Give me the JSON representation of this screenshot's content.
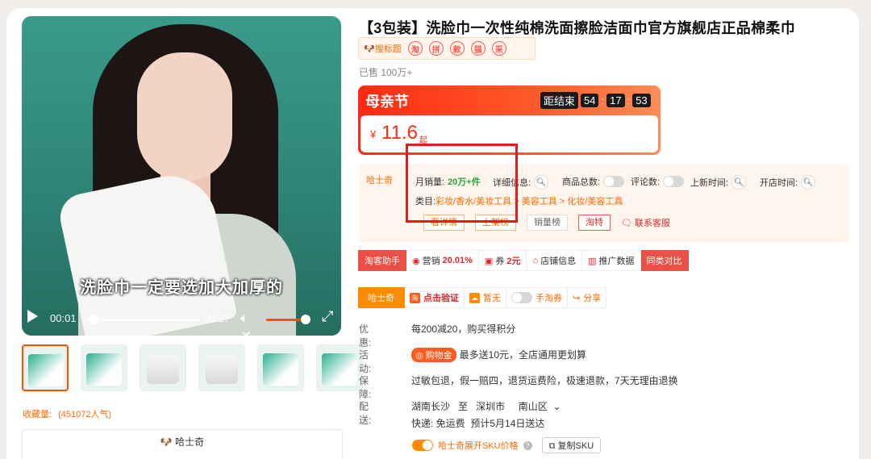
{
  "product": {
    "title": "【3包装】洗脸巾一次性纯棉洗面擦脸洁面巾官方旗舰店正品棉柔巾",
    "sold": "已售 100万+",
    "badge_label": "搜标题",
    "badge_icons": [
      "淘",
      "拼",
      "款",
      "猫",
      "采"
    ]
  },
  "video": {
    "caption": "洗脸巾一定要选加大加厚的",
    "current_time": "00:01",
    "duration": "00:27",
    "progress": 0.04,
    "volume": 0.85
  },
  "thumbnails": {
    "count": 6,
    "selected": 0
  },
  "favorites": {
    "label": "收藏量:",
    "value": "(451072人气)"
  },
  "husky_panel": {
    "label": "哈士奇"
  },
  "promo": {
    "title": "母亲节",
    "countdown_label": "距结束",
    "h": "54",
    "m": "17",
    "s": "53",
    "currency": "¥",
    "price": "11.6",
    "suffix": "起"
  },
  "analytics": {
    "brand": "哈士奇",
    "monthly_label": "月销量:",
    "monthly_value": "20万+件",
    "detail_label": "详细信息:",
    "total_label": "商品总数:",
    "review_label": "评论数:",
    "new_label": "上新时间:",
    "open_label": "开店时间:",
    "cat_label": "类目:",
    "cat_path": [
      "彩妆/香水/美妆工具",
      "美容工具",
      "化妆/美容工具"
    ],
    "cat_sep": " > ",
    "btn1": "看详情",
    "btn2": "上架榜",
    "btn3": "销量榜",
    "btn4": "淘特",
    "contact": "联系客服"
  },
  "toolbar": {
    "assistant": "淘客助手",
    "marketing_label": "营销",
    "marketing_value": "20.01%",
    "coupon_label": "券",
    "coupon_value": "2元",
    "shop_info": "店铺信息",
    "promo_data": "推广数据",
    "compare": "同类对比"
  },
  "toolbar2": {
    "husky": "哈士奇",
    "verify": "点击验证",
    "none": "暂无",
    "taobao": "手淘券",
    "share": "分享"
  },
  "info": {
    "discount_k": "优惠:",
    "discount_v": "每200减20，购买得积分",
    "activity_k": "活动:",
    "activity_badge": "购物金",
    "activity_v": "最多送10元，全店通用更划算",
    "guarantee_k": "保障:",
    "guarantee_v": "过敏包退，假一赔四，退货运费险，极速退款，7天无理由退换",
    "delivery_k": "配送:",
    "from": "湖南长沙",
    "to_label": "至",
    "city": "深圳市",
    "district": "南山区",
    "express": "快递: 免运费",
    "eta": "预计5月14日送达"
  },
  "sku": {
    "label": "哈士奇展开SKU价格",
    "copy": "复制SKU"
  },
  "colors": {
    "accent": "#ff5000",
    "red": "#e0262a",
    "green": "#2aa63d"
  }
}
